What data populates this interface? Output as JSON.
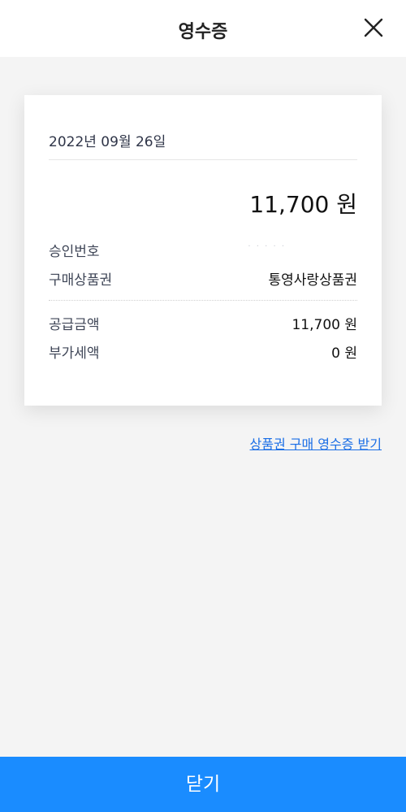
{
  "header": {
    "title": "영수증"
  },
  "receipt": {
    "date": "2022년 09월 26일",
    "total_amount": "11,700 원",
    "rows": [
      {
        "label": "승인번호",
        "value": "· · · · ·"
      },
      {
        "label": "구매상품권",
        "value": "통영사랑상품권"
      },
      {
        "label": "공급금액",
        "value": "11,700 원"
      },
      {
        "label": "부가세액",
        "value": "0 원"
      }
    ]
  },
  "link": {
    "label": "상품권 구매 영수증 받기"
  },
  "footer": {
    "button_label": "닫기"
  },
  "colors": {
    "accent": "#1a8cff",
    "link": "#1a6ee6",
    "background": "#f4f4f4"
  }
}
